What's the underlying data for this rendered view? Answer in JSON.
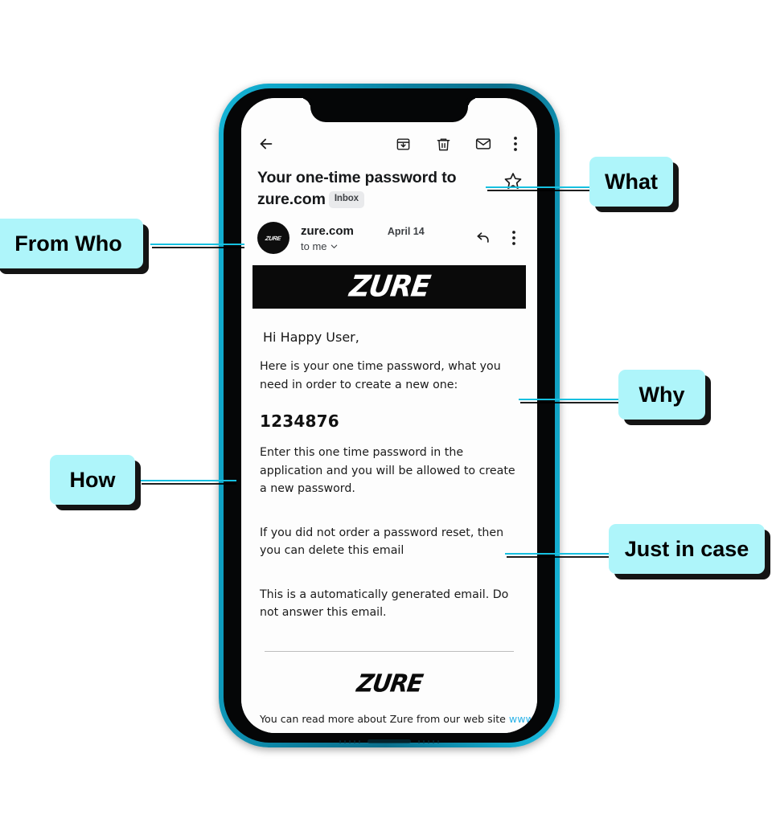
{
  "device": {
    "frame_color": "#0fa5c8",
    "bezel_color": "#050607"
  },
  "mail_app": {
    "toolbar": {
      "back_label": "Back",
      "archive_label": "Archive",
      "delete_label": "Delete",
      "mark_unread_label": "Mark as unread",
      "more_label": "More options"
    },
    "subject": "Your one-time password to zure.com",
    "label_chip": "Inbox",
    "star_label": "Star",
    "sender": {
      "avatar_text": "ZURE",
      "name": "zure.com",
      "date": "April 14",
      "recipient": "to me",
      "reply_label": "Reply",
      "more_label": "More"
    },
    "body": {
      "banner_logo": "ZURE",
      "greeting": "Hi Happy User,",
      "intro": "Here is your one time password, what you need in order to create a new one:",
      "otp_code": "1234876",
      "instruction": "Enter this one time password in the application and you will be allowed to create a new password.",
      "notice": "If you did not order a password reset, then you can delete this email",
      "auto_note": "This is a automatically generated email. Do not answer this email.",
      "footer_logo": "ZURE",
      "footer_text": "You can read more about Zure from our web site ",
      "footer_link": "www.zure.com"
    }
  },
  "annotations": {
    "accent_color": "#16c0e0",
    "chip_color": "#aef5fa",
    "callouts": [
      {
        "id": "what",
        "label": "What"
      },
      {
        "id": "from-who",
        "label": "From Who"
      },
      {
        "id": "why",
        "label": "Why"
      },
      {
        "id": "how",
        "label": "How"
      },
      {
        "id": "just-in-case",
        "label": "Just in case"
      }
    ]
  }
}
